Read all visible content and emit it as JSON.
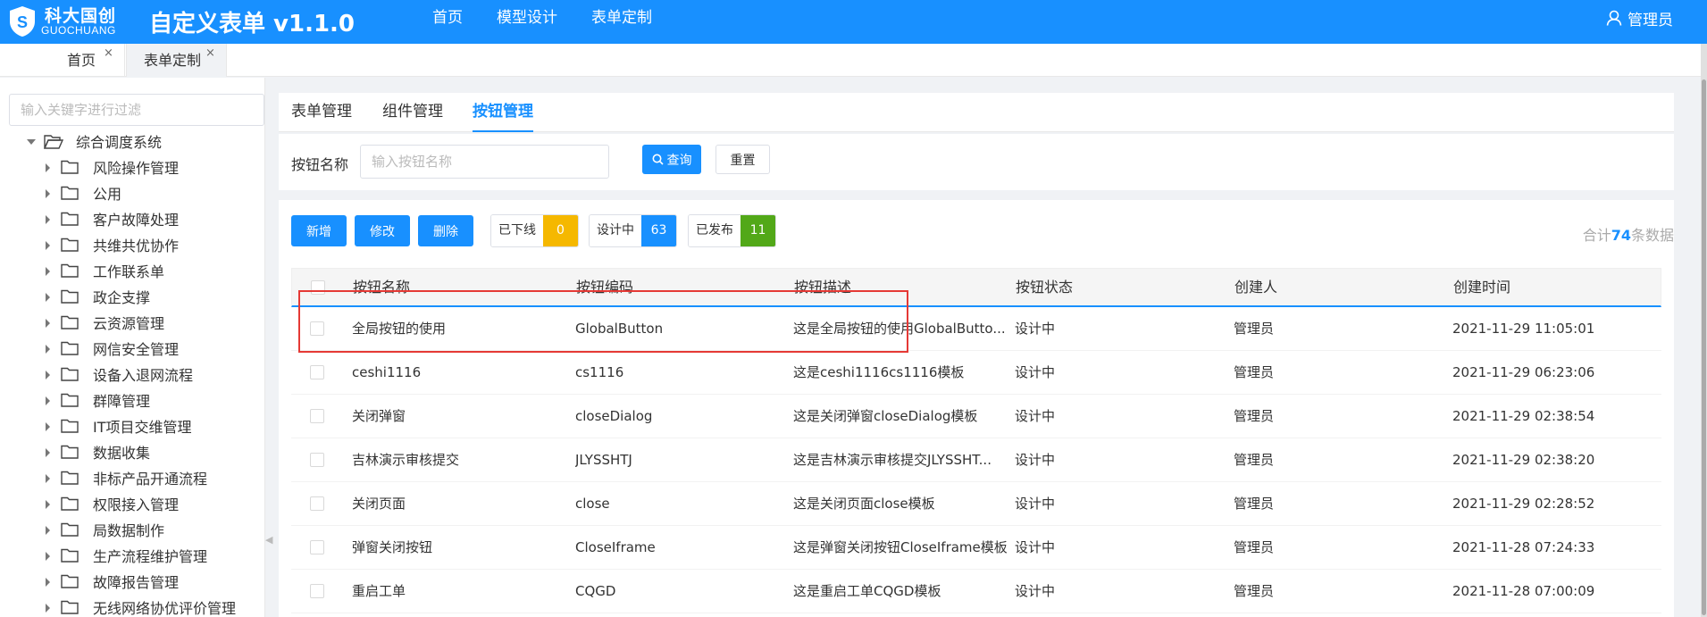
{
  "brand": {
    "cn": "科大国创",
    "en": "GUOCHUANG"
  },
  "app_title": "自定义表单 v1.1.0",
  "top_nav": [
    "首页",
    "模型设计",
    "表单定制"
  ],
  "user": {
    "name": "管理员"
  },
  "page_tabs": [
    {
      "label": "首页",
      "close": "×"
    },
    {
      "label": "表单定制",
      "close": "×"
    }
  ],
  "sidebar": {
    "filter_placeholder": "输入关键字进行过滤",
    "root": "综合调度系统",
    "items": [
      "风险操作管理",
      "公用",
      "客户故障处理",
      "共维共优协作",
      "工作联系单",
      "政企支撑",
      "云资源管理",
      "网信安全管理",
      "设备入退网流程",
      "群障管理",
      "IT项目交维管理",
      "数据收集",
      "非标产品开通流程",
      "权限接入管理",
      "局数据制作",
      "生产流程维护管理",
      "故障报告管理",
      "无线网络协优评价管理"
    ]
  },
  "sub_tabs": [
    "表单管理",
    "组件管理",
    "按钮管理"
  ],
  "search": {
    "label": "按钮名称",
    "placeholder": "输入按钮名称",
    "query_label": "查询",
    "reset_label": "重置"
  },
  "actions": {
    "add": "新增",
    "edit": "修改",
    "delete": "删除"
  },
  "stats": [
    {
      "label": "已下线",
      "count": "0",
      "color": "#f5b800"
    },
    {
      "label": "设计中",
      "count": "63",
      "color": "#1890ff"
    },
    {
      "label": "已发布",
      "count": "11",
      "color": "#52a818"
    }
  ],
  "total": {
    "prefix": "合计",
    "count": "74",
    "suffix": "条数据"
  },
  "table": {
    "columns": [
      "按钮名称",
      "按钮编码",
      "按钮描述",
      "按钮状态",
      "创建人",
      "创建时间"
    ],
    "rows": [
      {
        "name": "全局按钮的使用",
        "code": "GlobalButton",
        "desc": "这是全局按钮的使用GlobalButto...",
        "status": "设计中",
        "creator": "管理员",
        "time": "2021-11-29 11:05:01"
      },
      {
        "name": "ceshi1116",
        "code": "cs1116",
        "desc": "这是ceshi1116cs1116模板",
        "status": "设计中",
        "creator": "管理员",
        "time": "2021-11-29 06:23:06"
      },
      {
        "name": "关闭弹窗",
        "code": "closeDialog",
        "desc": "这是关闭弹窗closeDialog模板",
        "status": "设计中",
        "creator": "管理员",
        "time": "2021-11-29 02:38:54"
      },
      {
        "name": "吉林演示审核提交",
        "code": "JLYSSHTJ",
        "desc": "这是吉林演示审核提交JLYSSHT...",
        "status": "设计中",
        "creator": "管理员",
        "time": "2021-11-29 02:38:20"
      },
      {
        "name": "关闭页面",
        "code": "close",
        "desc": "这是关闭页面close模板",
        "status": "设计中",
        "creator": "管理员",
        "time": "2021-11-29 02:28:52"
      },
      {
        "name": "弹窗关闭按钮",
        "code": "CloseIframe",
        "desc": "这是弹窗关闭按钮CloseIframe模板",
        "status": "设计中",
        "creator": "管理员",
        "time": "2021-11-28 07:24:33"
      },
      {
        "name": "重启工单",
        "code": "CQGD",
        "desc": "这是重启工单CQGD模板",
        "status": "设计中",
        "creator": "管理员",
        "time": "2021-11-28 07:00:09"
      }
    ]
  },
  "colors": {
    "primary": "#1890ff",
    "highlight": "#e53935"
  }
}
